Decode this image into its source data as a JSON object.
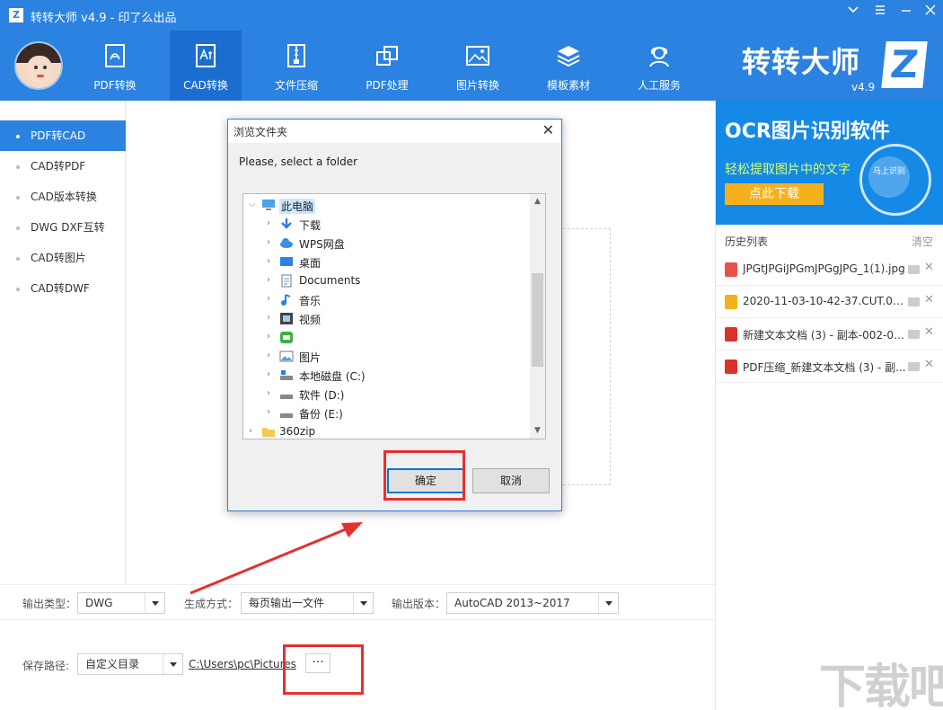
{
  "window": {
    "title": "转转大师 v4.9 - 印了么出品",
    "logo": "Z",
    "controls": [
      "minimize-icon",
      "menu-icon",
      "window-minimize",
      "close-icon"
    ]
  },
  "nav": {
    "items": [
      {
        "label": "PDF转换",
        "icon": "pdf-icon"
      },
      {
        "label": "CAD转换",
        "icon": "cad-icon"
      },
      {
        "label": "文件压缩",
        "icon": "zip-icon"
      },
      {
        "label": "PDF处理",
        "icon": "pdf-process-icon"
      },
      {
        "label": "图片转换",
        "icon": "image-icon"
      },
      {
        "label": "模板素材",
        "icon": "layers-icon"
      },
      {
        "label": "人工服务",
        "icon": "support-icon"
      }
    ],
    "active": "CAD转换",
    "brand": "转转大师",
    "brand_logo": "Z",
    "brand_version": "v4.9"
  },
  "sidebar": {
    "items": [
      {
        "label": "PDF转CAD"
      },
      {
        "label": "CAD转PDF"
      },
      {
        "label": "CAD版本转换"
      },
      {
        "label": "DWG DXF互转"
      },
      {
        "label": "CAD转图片"
      },
      {
        "label": "CAD转DWF"
      }
    ],
    "active": "PDF转CAD"
  },
  "options": {
    "output_type_label": "输出类型：",
    "output_type_value": "DWG",
    "gen_mode_label": "生成方式：",
    "gen_mode_value": "每页输出一文件",
    "version_label": "输出版本：",
    "version_value": "AutoCAD 2013~2017",
    "save_path_label": "保存路径:",
    "save_path_mode": "自定义目录",
    "save_path": "C:\\Users\\pc\\Pictures",
    "browse_label": "···"
  },
  "ad": {
    "title": "OCR图片识别软件",
    "subtitle": "轻松提取图片中的文字",
    "button": "点此下载",
    "circle_text": "马上识别"
  },
  "history": {
    "title": "历史列表",
    "clear": "清空",
    "items": [
      {
        "name": "JPGtJPGiJPGmJPGgJPG_1(1).jpg",
        "type": "image",
        "color": "#e8504a"
      },
      {
        "name": "2020-11-03-10-42-37.CUT.00'...",
        "type": "video",
        "color": "#f5b01b"
      },
      {
        "name": "新建文本文档 (3) - 副本-002-00...",
        "type": "pdf",
        "color": "#d9342b"
      },
      {
        "name": "PDF压缩_新建文本文档 (3) - 副...",
        "type": "pdf",
        "color": "#d9342b"
      }
    ]
  },
  "dialog": {
    "title": "浏览文件夹",
    "prompt": "Please, select a folder",
    "tree": [
      {
        "label": "此电脑",
        "icon": "computer-icon",
        "level": 0,
        "expanded": true
      },
      {
        "label": "下载",
        "icon": "download-icon",
        "level": 1
      },
      {
        "label": "WPS网盘",
        "icon": "cloud-icon",
        "level": 1
      },
      {
        "label": "桌面",
        "icon": "desktop-icon",
        "level": 1
      },
      {
        "label": "Documents",
        "icon": "document-icon",
        "level": 1
      },
      {
        "label": "音乐",
        "icon": "music-icon",
        "level": 1
      },
      {
        "label": "视频",
        "icon": "video-icon",
        "level": 1
      },
      {
        "label": "",
        "icon": "app-icon",
        "level": 1
      },
      {
        "label": "图片",
        "icon": "picture-icon",
        "level": 1
      },
      {
        "label": "本地磁盘 (C:)",
        "icon": "drive-icon",
        "level": 1
      },
      {
        "label": "软件 (D:)",
        "icon": "drive-icon",
        "level": 1
      },
      {
        "label": "备份 (E:)",
        "icon": "drive-icon",
        "level": 1
      },
      {
        "label": "360zip",
        "icon": "folder-icon",
        "level": 0
      }
    ],
    "ok": "确定",
    "cancel": "取消"
  },
  "watermark": "下载吧",
  "colors": {
    "primary": "#2b82e0",
    "active_nav": "#1b6ed0",
    "annotation": "#e53030"
  }
}
